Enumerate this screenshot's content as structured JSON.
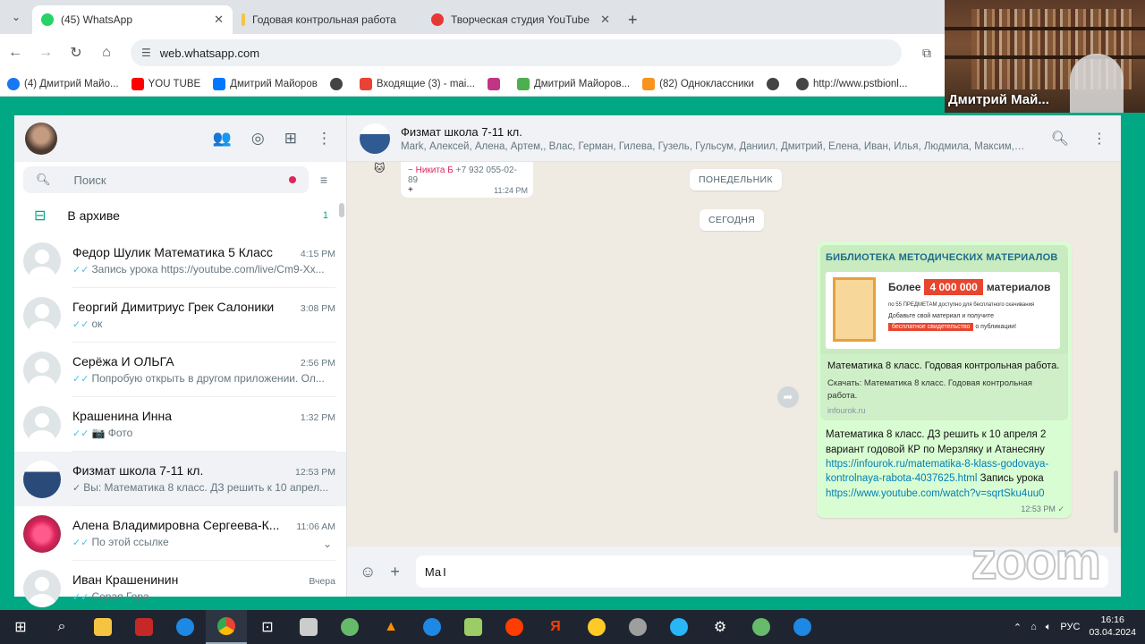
{
  "browser": {
    "tabs": [
      {
        "title": "(45) WhatsApp",
        "color": "#25d366",
        "active": true
      },
      {
        "title": "Годовая контрольная работа",
        "color": "#f5c542",
        "active": false
      },
      {
        "title": "Творческая студия YouTube",
        "color": "#e53935",
        "active": false
      }
    ],
    "url": "web.whatsapp.com",
    "bookmarks": [
      {
        "label": "(4) Дмитрий Майо...",
        "color": "#1877f2"
      },
      {
        "label": "YOU TUBE",
        "color": "#ff0000"
      },
      {
        "label": "Дмитрий Майоров",
        "color": "#0077ff"
      },
      {
        "label": "",
        "color": "#444"
      },
      {
        "label": "Входящие (3) - mai...",
        "color": "#ea4335"
      },
      {
        "label": "",
        "color": "#c13584"
      },
      {
        "label": "Дмитрий Майоров...",
        "color": "#4caf50"
      },
      {
        "label": "(82) Одноклассники",
        "color": "#f7931e"
      },
      {
        "label": "",
        "color": "#444"
      },
      {
        "label": "http://www.pstbionl...",
        "color": "#444"
      }
    ]
  },
  "video": {
    "participant": "Дмитрий Май..."
  },
  "sidebar": {
    "search_placeholder": "Поиск",
    "archive_label": "В архиве",
    "archive_count": "1",
    "chats": [
      {
        "name": "Федор Шулик Математика 5 Класс",
        "time": "4:15 PM",
        "preview": "Запись урока https://youtube.com/live/Cm9-Xx...",
        "avatar": "default"
      },
      {
        "name": "Георгий Димитриус Грек Салоники",
        "time": "3:08 PM",
        "preview": "ок",
        "avatar": "default"
      },
      {
        "name": "Серёжа И ОЛЬГА",
        "time": "2:56 PM",
        "preview": "Попробую открыть в другом приложении. Ол...",
        "avatar": "default"
      },
      {
        "name": "Крашенина Инна",
        "time": "1:32 PM",
        "preview": "📷 Фото",
        "avatar": "default"
      },
      {
        "name": "Физмат школа 7-11 кл.",
        "time": "12:53 PM",
        "preview": "Вы: Математика 8 класс. ДЗ решить к 10 апрел...",
        "avatar": "group"
      },
      {
        "name": "Алена Владимировна Сергеева-К...",
        "time": "11:06 AM",
        "preview": "По этой ссылке",
        "avatar": "flower"
      },
      {
        "name": "Иван Крашенинин",
        "time": "Вчера",
        "preview": "Серая Гора",
        "avatar": "default"
      }
    ]
  },
  "conversation": {
    "title": "Физмат школа 7-11 кл.",
    "members": "Mark, Алексей, Алена, Артем,, Влас, Герман, Гилева, Гузель, Гульсум, Даниил, Дмитрий, Елена, Иван, Илья, Людмила, Максим,, Марианна...",
    "incoming": {
      "sender": "~ Никита Б",
      "phone": "+7 932 055-02-89",
      "text": "+",
      "time": "11:24 PM"
    },
    "day1": "ПОНЕДЕЛЬНИК",
    "day2": "СЕГОДНЯ",
    "outgoing": {
      "preview_banner": "БИБЛИОТЕКА МЕТОДИЧЕСКИХ МАТЕРИАЛОВ",
      "banner_more": "Более",
      "banner_count": "4 000 000",
      "banner_materials": "материалов",
      "banner_line2": "по 55 ПРЕДМЕТАМ доступно для бесплатного скачивания",
      "banner_line3": "Добавьте свой материал и получите",
      "banner_free": "бесплатное свидетельство",
      "banner_tail": "о публикации!",
      "preview_title": "Математика 8 класс. Годовая контрольная работа.",
      "preview_desc": "Скачать: Математика 8 класс. Годовая контрольная работа.",
      "preview_host": "infourok.ru",
      "text1": "Математика 8 класс. ДЗ решить к 10 апреля 2 вариант годовой КР по Мерзляку и Атанесяну ",
      "link1": "https://infourok.ru/matematika-8-klass-godovaya-kontrolnaya-rabota-4037625.html",
      "text2": " Запись урока ",
      "link2": "https://www.youtube.com/watch?v=sqrtSku4uu0",
      "time": "12:53 PM"
    },
    "composer_value": "Ма"
  },
  "zoom_watermark": "zoom",
  "taskbar": {
    "lang": "РУС",
    "time": "16:16",
    "date": "03.04.2024",
    "apps": [
      {
        "name": "windows-start",
        "color": "#ffffff"
      },
      {
        "name": "search",
        "color": "#ffffff"
      },
      {
        "name": "file-explorer",
        "color": "#f5c542"
      },
      {
        "name": "app-red",
        "color": "#c62828"
      },
      {
        "name": "edge",
        "color": "#1e88e5"
      },
      {
        "name": "chrome",
        "color": "#4caf50"
      },
      {
        "name": "store",
        "color": "#ffffff"
      },
      {
        "name": "calculator",
        "color": "#cccccc"
      },
      {
        "name": "paint",
        "color": "#66bb6a"
      },
      {
        "name": "vlc",
        "color": "#ff8f00"
      },
      {
        "name": "app-blue",
        "color": "#1e88e5"
      },
      {
        "name": "notepad",
        "color": "#9ccc65"
      },
      {
        "name": "yandex-browser",
        "color": "#ff3d00"
      },
      {
        "name": "yandex",
        "color": "#ff3d00"
      },
      {
        "name": "yandex-market",
        "color": "#ffca28"
      },
      {
        "name": "app-gray",
        "color": "#9e9e9e"
      },
      {
        "name": "telegram",
        "color": "#29b6f6"
      },
      {
        "name": "settings",
        "color": "#ffffff"
      },
      {
        "name": "torrent",
        "color": "#66bb6a"
      },
      {
        "name": "zoom",
        "color": "#1e88e5"
      }
    ]
  }
}
